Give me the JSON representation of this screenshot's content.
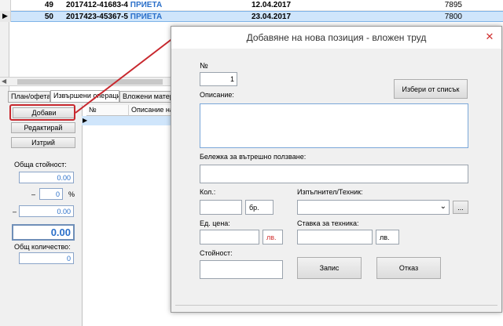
{
  "grid": {
    "rows": [
      {
        "no": "49",
        "doc": "2017412-41683-4",
        "status": "ПРИЕТА",
        "date": "12.04.2017",
        "sum": "7895"
      },
      {
        "no": "50",
        "doc": "2017423-45367-5",
        "status": "ПРИЕТА",
        "date": "23.04.2017",
        "sum": "7800"
      }
    ]
  },
  "tabs": [
    "План/офета",
    "Извършени операции",
    "Вложени матери"
  ],
  "subgrid": {
    "headers": [
      "№",
      "Описание на р"
    ]
  },
  "left": {
    "add_button": "Добави",
    "edit_button": "Редактирай",
    "delete_button": "Изтрий",
    "total_label": "Обща стойност:",
    "total_value": "0.00",
    "discount_sign": "–",
    "discount_percent": "0",
    "percent_sign": "%",
    "discount_amount_sign": "–",
    "discount_amount": "0.00",
    "grand_total": "0.00",
    "quantity_label": "Общ количество:",
    "quantity_value": "0"
  },
  "dialog": {
    "title": "Добавяне на нова позиция - вложен труд",
    "close_glyph": "✕",
    "number_label": "№",
    "number_value": "1",
    "choose_button": "Избери от списък",
    "description_label": "Описание:",
    "internal_note_label": "Бележка за вътрешно ползване:",
    "qty_label": "Кол.:",
    "qty_unit": "бр.",
    "executor_label": "Изпълнител/Техник:",
    "executor_dropdown_arrow": "⌄",
    "executor_more_button": "...",
    "unit_price_label": "Ед. цена:",
    "unit_price_currency": "лв.",
    "tech_rate_label": "Ставка за техника:",
    "tech_rate_currency": "лв.",
    "value_label": "Стойност:",
    "save_button": "Запис",
    "cancel_button": "Отказ"
  },
  "colors": {
    "status_blue": "#2a6fc9",
    "annotation_red": "#c8282e",
    "currency_red": "#d03030"
  }
}
